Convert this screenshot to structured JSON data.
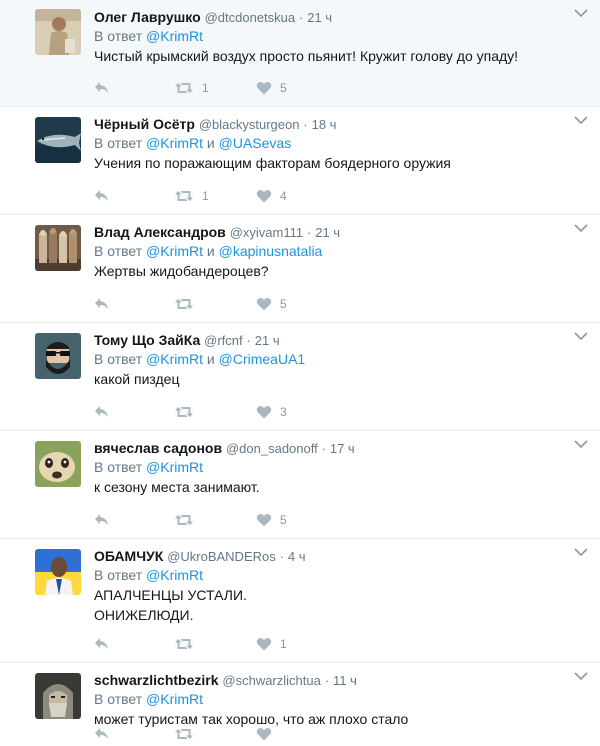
{
  "tweets": [
    {
      "name": "Олег Лаврушко",
      "handle": "@dtcdonetskua",
      "sep": "·",
      "time": "21 ч",
      "reply_prefix": "В ответ ",
      "mention1": "@KrimRt",
      "conj": "",
      "mention2": "",
      "lines": [
        "Чистый крымский воздух просто пьянит! Кружит голову до упаду!"
      ],
      "retweets": "1",
      "likes": "5",
      "avatar_icon": "person-photo-icon",
      "avatar_color": "#b7a07d"
    },
    {
      "name": "Чёрный Осётр",
      "handle": "@blackysturgeon",
      "sep": "·",
      "time": "18 ч",
      "reply_prefix": "В ответ ",
      "mention1": "@KrimRt",
      "conj": " и ",
      "mention2": "@UASevas",
      "lines": [
        "Учения по поражающим факторам боядерного оружия"
      ],
      "retweets": "1",
      "likes": "4",
      "avatar_icon": "sturgeon-fish-icon",
      "avatar_color": "#2d4e60"
    },
    {
      "name": "Влад Александров",
      "handle": "@xyivam111",
      "sep": "·",
      "time": "21 ч",
      "reply_prefix": "В ответ ",
      "mention1": "@KrimRt",
      "conj": " и ",
      "mention2": "@kapinusnatalia",
      "lines": [
        "Жертвы жидобандероцев?"
      ],
      "retweets": "",
      "likes": "5",
      "avatar_icon": "group-photo-icon",
      "avatar_color": "#8a6a4c"
    },
    {
      "name": "Тому Що ЗайКа",
      "handle": "@rfcnf",
      "sep": "·",
      "time": "21 ч",
      "reply_prefix": "В ответ ",
      "mention1": "@KrimRt",
      "conj": " и ",
      "mention2": "@CrimeaUA1",
      "lines": [
        "какой пиздец"
      ],
      "retweets": "",
      "likes": "3",
      "avatar_icon": "bearded-sunglasses-icon",
      "avatar_color": "#46626a"
    },
    {
      "name": "вячеслав садонов",
      "handle": "@don_sadonoff",
      "sep": "·",
      "time": "17 ч",
      "reply_prefix": "В ответ ",
      "mention1": "@KrimRt",
      "conj": "",
      "mention2": "",
      "lines": [
        "к сезону места занимают."
      ],
      "retweets": "",
      "likes": "5",
      "avatar_icon": "meerkat-icon",
      "avatar_color": "#8aa35c"
    },
    {
      "name": "ОБАМЧУК",
      "handle": "@UkroBANDERos",
      "sep": "·",
      "time": "4 ч",
      "reply_prefix": "В ответ ",
      "mention1": "@KrimRt",
      "conj": "",
      "mention2": "",
      "lines": [
        "АПАЛЧЕНЦЫ УСТАЛИ.",
        "ОНИЖЕЛЮДИ."
      ],
      "retweets": "",
      "likes": "1",
      "avatar_icon": "portrait-flag-icon",
      "avatar_color": "#e8d27a"
    },
    {
      "name": "schwarzlichtbezirk",
      "handle": "@schwarzlichtua",
      "sep": "·",
      "time": "11 ч",
      "reply_prefix": "В ответ ",
      "mention1": "@KrimRt",
      "conj": "",
      "mention2": "",
      "lines": [
        "может туристам так хорошо, что аж плохо стало"
      ],
      "retweets": "",
      "likes": "",
      "avatar_icon": "warrior-helmet-icon",
      "avatar_color": "#5a5a52"
    }
  ]
}
